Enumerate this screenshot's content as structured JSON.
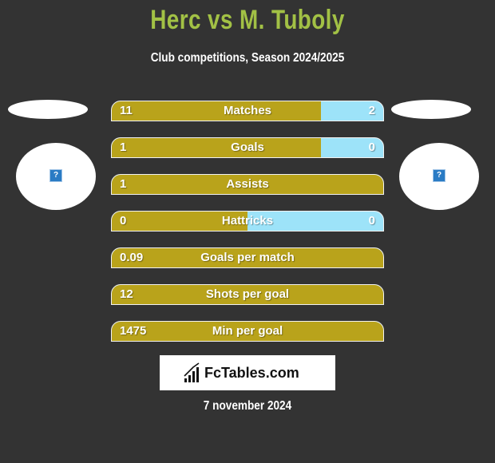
{
  "header": {
    "title": "Herc vs M. Tuboly",
    "subtitle": "Club competitions, Season 2024/2025"
  },
  "players": {
    "left": {
      "logo_icon": "broken-image-icon"
    },
    "right": {
      "logo_icon": "broken-image-icon"
    }
  },
  "colors": {
    "left": "#b9a31b",
    "right": "#9de3f9",
    "title": "#a2c145",
    "background": "#333333"
  },
  "stats": [
    {
      "label": "Matches",
      "left": "11",
      "right": "2",
      "left_share": 0.77
    },
    {
      "label": "Goals",
      "left": "1",
      "right": "0",
      "left_share": 0.77
    },
    {
      "label": "Assists",
      "left": "1",
      "right": "",
      "left_share": 1.0
    },
    {
      "label": "Hattricks",
      "left": "0",
      "right": "0",
      "left_share": 0.5
    },
    {
      "label": "Goals per match",
      "left": "0.09",
      "right": "",
      "left_share": 1.0
    },
    {
      "label": "Shots per goal",
      "left": "12",
      "right": "",
      "left_share": 1.0
    },
    {
      "label": "Min per goal",
      "left": "1475",
      "right": "",
      "left_share": 1.0
    }
  ],
  "footer": {
    "brand": "FcTables.com",
    "date": "7 november 2024"
  }
}
